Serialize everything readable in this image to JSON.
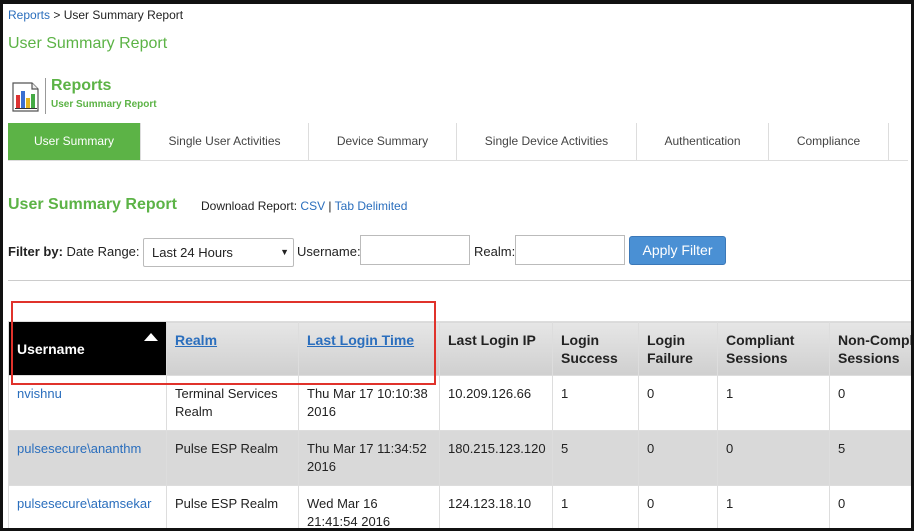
{
  "breadcrumb": {
    "root": "Reports",
    "separator": " > ",
    "current": "User Summary Report"
  },
  "page_title": "User Summary Report",
  "header": {
    "title": "Reports",
    "subtitle": "User Summary Report",
    "icon": "report-chart-icon"
  },
  "tabs": [
    {
      "label": "User Summary",
      "active": true
    },
    {
      "label": "Single User Activities",
      "active": false
    },
    {
      "label": "Device Summary",
      "active": false
    },
    {
      "label": "Single Device Activities",
      "active": false
    },
    {
      "label": "Authentication",
      "active": false
    },
    {
      "label": "Compliance",
      "active": false
    }
  ],
  "section": {
    "title": "User Summary Report",
    "download_label": "Download Report:",
    "csv": "CSV",
    "sep": " | ",
    "tab": "Tab Delimited"
  },
  "filter": {
    "label": "Filter by:",
    "date_range_label": "Date Range:",
    "date_range_value": "Last 24 Hours",
    "username_label": "Username:",
    "username_value": "",
    "realm_label": "Realm:",
    "realm_value": "",
    "apply": "Apply Filter"
  },
  "table": {
    "columns": [
      "Username",
      "Realm",
      "Last Login Time",
      "Last Login IP",
      "Login Success",
      "Login Failure",
      "Compliant Sessions",
      "Non-Compliant Sessions"
    ],
    "rows": [
      [
        "nvishnu",
        "Terminal Services Realm",
        "Thu Mar 17 10:10:38 2016",
        "10.209.126.66",
        "1",
        "0",
        "1",
        "0"
      ],
      [
        "pulsesecure\\ananthm",
        "Pulse ESP Realm",
        "Thu Mar 17 11:34:52 2016",
        "180.215.123.120",
        "5",
        "0",
        "0",
        "5"
      ],
      [
        "pulsesecure\\atamsekar",
        "Pulse ESP Realm",
        "Wed Mar 16 21:41:54 2016",
        "124.123.18.10",
        "1",
        "0",
        "1",
        "0"
      ]
    ]
  },
  "colors": {
    "accent": "#5cb346",
    "link": "#2a6ebd",
    "button": "#4a90d4",
    "highlight": "#e0322b"
  }
}
